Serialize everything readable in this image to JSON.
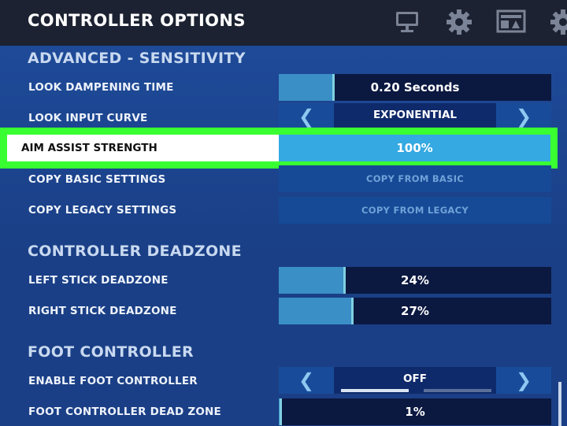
{
  "header": {
    "title": "CONTROLLER OPTIONS",
    "icons": [
      "monitor-icon",
      "gear-icon",
      "news-icon",
      "gear-icon"
    ]
  },
  "sections": {
    "advanced_sensitivity": "ADVANCED - SENSITIVITY",
    "controller_deadzone": "CONTROLLER DEADZONE",
    "foot_controller": "FOOT CONTROLLER"
  },
  "rows": {
    "look_dampening_time": {
      "label": "LOOK DAMPENING TIME",
      "value": "0.20 Seconds",
      "fill_fraction": 0.2
    },
    "look_input_curve": {
      "label": "LOOK INPUT CURVE",
      "value": "EXPONENTIAL"
    },
    "aim_assist_strength": {
      "label": "AIM ASSIST STRENGTH",
      "value": "100%",
      "fill_fraction": 1.0
    },
    "copy_basic_settings": {
      "label": "COPY BASIC SETTINGS",
      "button": "COPY FROM BASIC"
    },
    "copy_legacy_settings": {
      "label": "COPY LEGACY SETTINGS",
      "button": "COPY FROM LEGACY"
    },
    "left_stick_deadzone": {
      "label": "LEFT STICK DEADZONE",
      "value": "24%",
      "fill_fraction": 0.24
    },
    "right_stick_deadzone": {
      "label": "RIGHT STICK DEADZONE",
      "value": "27%",
      "fill_fraction": 0.27
    },
    "enable_foot_controller": {
      "label": "ENABLE FOOT CONTROLLER",
      "value": "OFF"
    },
    "foot_controller_dead_zone": {
      "label": "FOOT CONTROLLER DEAD ZONE",
      "value": "1%",
      "fill_fraction": 0.01
    }
  },
  "colors": {
    "highlight": "#39ff32",
    "slider_fill": "#3a8fc6",
    "active_fill": "#35a9e2",
    "background": "#1b3f86"
  }
}
